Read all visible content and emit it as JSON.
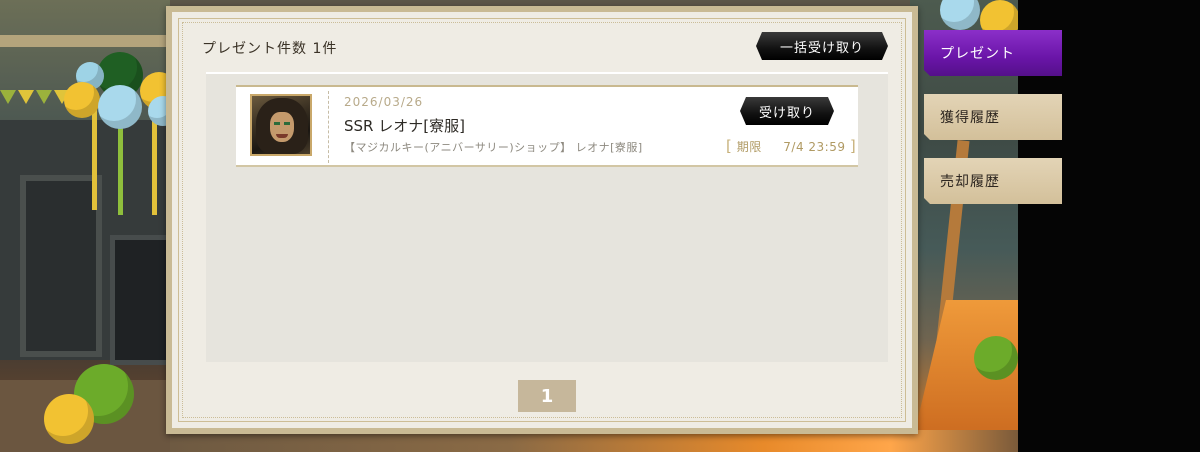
{
  "panel": {
    "title": "プレゼント件数 1件",
    "receive_all_label": "一括受け取り"
  },
  "items": [
    {
      "date": "2026/03/26",
      "name": "SSR レオナ[寮服]",
      "source": "【マジカルキー(アニバーサリー)ショップ】 レオナ[寮服]",
      "receive_label": "受け取り",
      "deadline_label": "期限",
      "deadline_value": "7/4 23:59"
    }
  ],
  "pager": {
    "current_page": "1"
  },
  "tabs": [
    {
      "label": "プレゼント",
      "active": true
    },
    {
      "label": "獲得履歴",
      "active": false
    },
    {
      "label": "売却履歴",
      "active": false
    }
  ],
  "colors": {
    "active_tab": "#6a15a8",
    "inactive_tab": "#dccaa6",
    "panel_border": "#c9ba94",
    "deadline_text": "#b09a63"
  }
}
